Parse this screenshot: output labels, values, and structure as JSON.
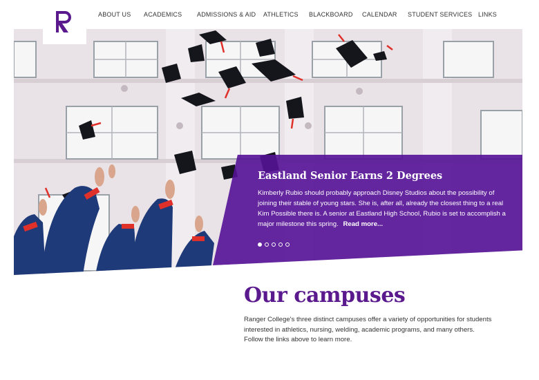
{
  "nav": {
    "logo_letter": "R",
    "items": [
      {
        "label": "ABOUT US"
      },
      {
        "label": "ACADEMICS"
      },
      {
        "label": "ADMISSIONS & AID"
      },
      {
        "label": "ATHLETICS"
      },
      {
        "label": "BLACKBOARD"
      },
      {
        "label": "CALENDAR"
      },
      {
        "label": "STUDENT SERVICES"
      },
      {
        "label": "LINKS"
      }
    ]
  },
  "hero": {
    "title": "Eastland Senior Earns 2 Degrees",
    "body": "Kimberly Rubio should probably approach Disney Studios about the possibility of joining their stable of young stars. She is, after all, already the closest thing to a real Kim Possible there is. A senior at Eastland High School, Rubio is set to accomplish a major milestone this spring.",
    "read_more": "Read more...",
    "slides_total": 5,
    "active_slide": 1
  },
  "campuses": {
    "title": "Our campuses",
    "body": "Ranger College's three distinct campuses offer a variety of opportunities for students interested in athletics, nursing, welding, academic programs, and many others. Follow the links above to learn more."
  },
  "colors": {
    "brand_purple": "#5a1a8e",
    "caption_overlay": "#541296",
    "gown_blue": "#1f3a78",
    "tassel_red": "#e0302a"
  }
}
